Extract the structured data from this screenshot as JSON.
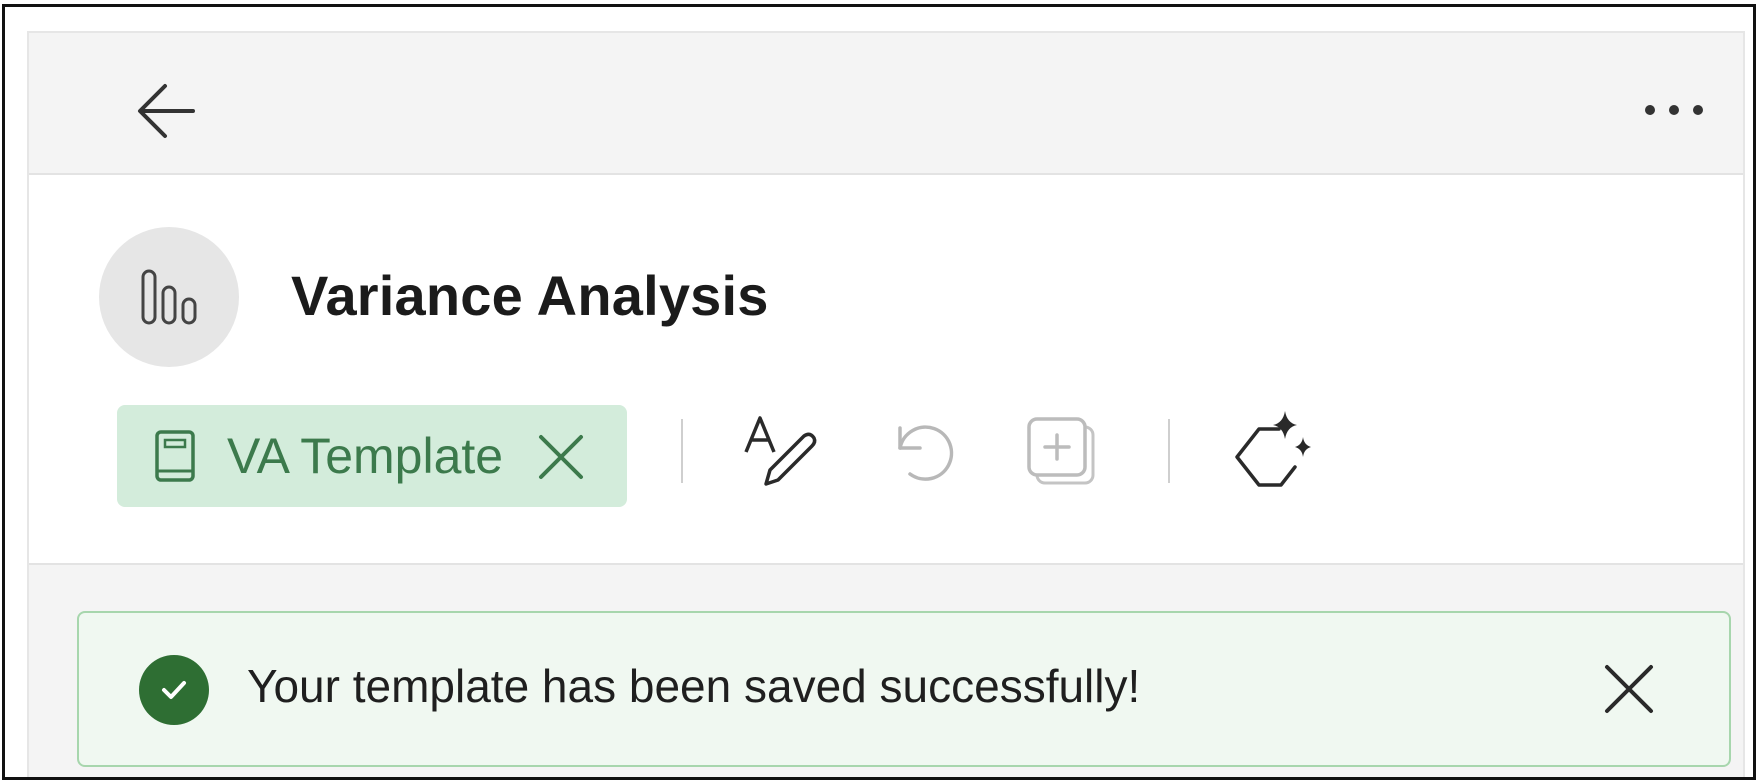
{
  "header": {
    "title": "Variance Analysis"
  },
  "template_chip": {
    "label": "VA Template",
    "icon": "book-icon",
    "close_icon": "close-icon",
    "background": "#d3ecdb",
    "text_color": "#3c7a4c"
  },
  "toolbar": {
    "items": [
      {
        "icon": "text-edit-icon",
        "enabled": true
      },
      {
        "icon": "undo-icon",
        "enabled": false
      },
      {
        "icon": "add-copy-icon",
        "enabled": false
      },
      {
        "icon": "ai-sparkle-hexagon-icon",
        "enabled": true
      }
    ]
  },
  "topbar": {
    "back_icon": "arrow-left-icon",
    "more_icon": "more-horizontal-icon"
  },
  "toast": {
    "message": "Your template has been saved successfully!",
    "status": "success",
    "accent": "#2e6e33",
    "background": "#f0f8f1"
  }
}
